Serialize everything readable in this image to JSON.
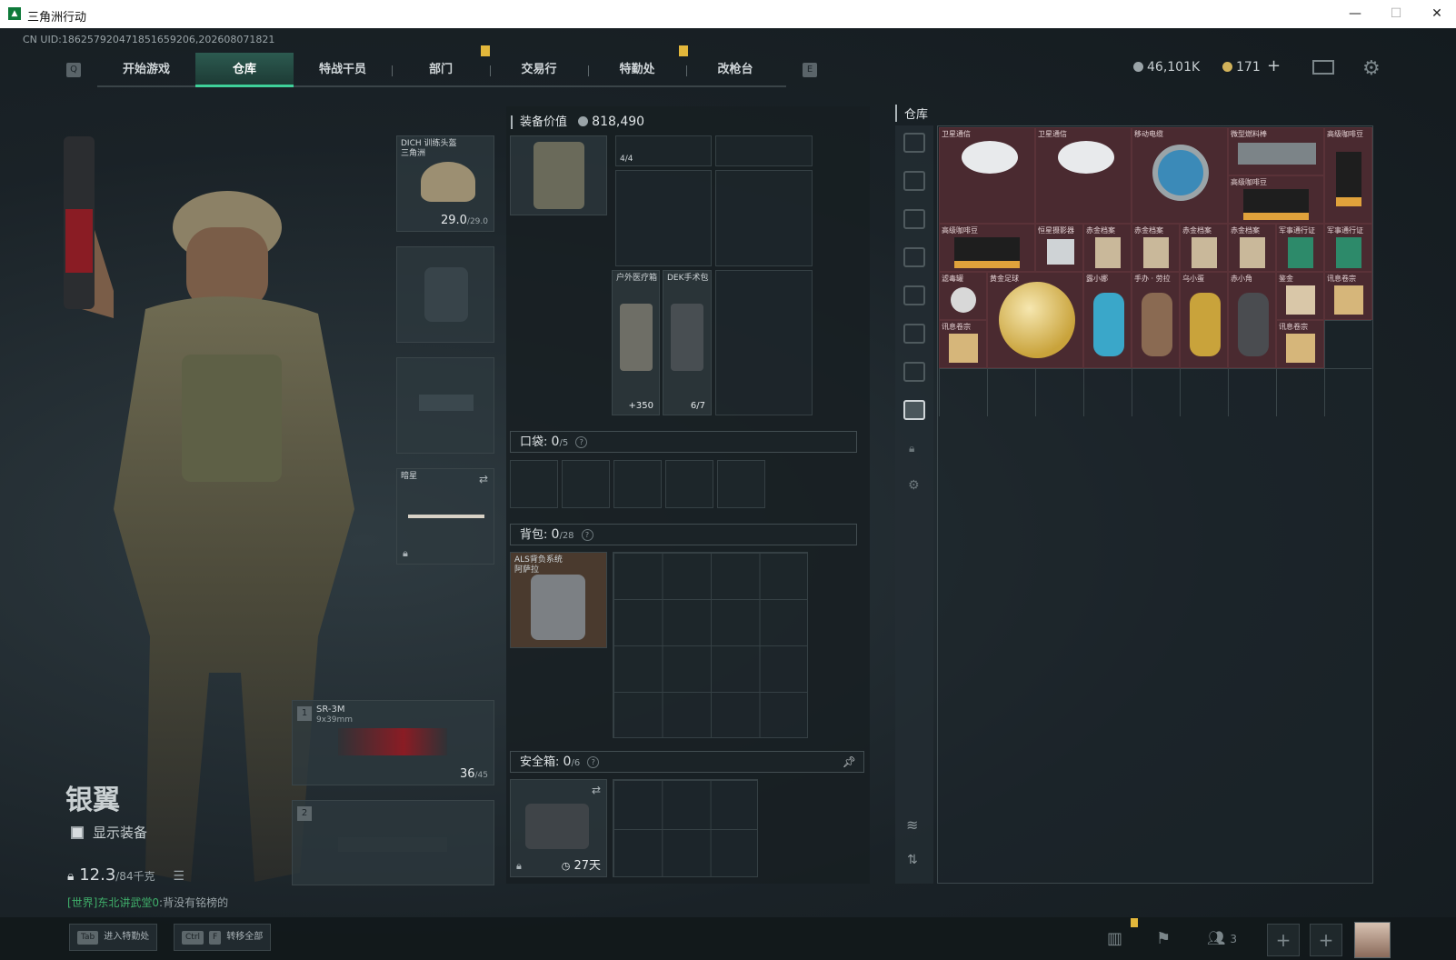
{
  "window": {
    "title": "三角洲行动"
  },
  "header": {
    "uid": "CN UID:18625792047185165920​6,202608071821",
    "key_left": "Q",
    "key_right": "E",
    "tabs": [
      "开始游戏",
      "仓库",
      "特战干员",
      "部门",
      "交易行",
      "特勤处",
      "改枪台"
    ],
    "active_tab": "仓库",
    "currency_a": "46,101K",
    "currency_b": "171",
    "plus": "+",
    "colors": {
      "accent": "#3fd19a",
      "tab_active": "#2c5a50",
      "marker": "#e2b73b"
    }
  },
  "character": {
    "name": "银翼",
    "show_equipment": "显示装备",
    "weight": "12.3",
    "weight_max": "/84千克"
  },
  "chat": {
    "channel": "[世界]",
    "user": "东北讲武堂0",
    "message": "背没有铭榜的"
  },
  "equipment": {
    "helmet": {
      "label": "DICH 训练头盔\n三角洲",
      "value": "29.0",
      "max": "/29.0"
    },
    "melee": {
      "label": "暗星"
    },
    "primary": {
      "index": "1",
      "name": "SR-3M",
      "caliber": "9x39mm",
      "ammo": "36",
      "ammo_max": "/45"
    },
    "secondary": {
      "index": "2"
    }
  },
  "loadout": {
    "value_label": "装备价值",
    "value": "818,490",
    "rig_count": "4/4",
    "medkit": {
      "label": "户外医疗箱",
      "value": "+350"
    },
    "surgery": {
      "label": "DEK手术包",
      "value": "6/7"
    },
    "pocket": {
      "label": "口袋:",
      "value": "0",
      "max": "/5"
    },
    "backpack": {
      "label": "背包:",
      "value": "0",
      "max": "/28",
      "item": "ALS背负系统\n阿萨拉"
    },
    "safebox": {
      "label": "安全箱:",
      "value": "0",
      "max": "/6",
      "days": "27天"
    }
  },
  "warehouse": {
    "title": "仓库",
    "items": [
      {
        "label": "卫星通信"
      },
      {
        "label": "卫星通信"
      },
      {
        "label": "移动电缆"
      },
      {
        "label": "微型燃料棒"
      },
      {
        "label": "高级咖啡豆"
      },
      {
        "label": "高级咖啡豆"
      },
      {
        "label": "高级咖啡豆"
      },
      {
        "label": "恒星摄影器"
      },
      {
        "label": "赤金档案"
      },
      {
        "label": "赤金档案"
      },
      {
        "label": "赤金档案"
      },
      {
        "label": "赤金档案"
      },
      {
        "label": "军事通行证"
      },
      {
        "label": "军事通行证"
      },
      {
        "label": "滤毒罐"
      },
      {
        "label": "黄金足球"
      },
      {
        "label": "露小娜"
      },
      {
        "label": "手办 · 劳拉"
      },
      {
        "label": "乌小蛋"
      },
      {
        "label": "赤小角"
      },
      {
        "label": "鉴金"
      },
      {
        "label": "讯息卷宗"
      },
      {
        "label": "讯息卷宗"
      },
      {
        "label": "讯息卷宗"
      }
    ]
  },
  "footer": {
    "hint1_key": "Tab",
    "hint1": "进入特勤处",
    "hint2_key1": "Ctrl",
    "hint2_key2": "F",
    "hint2": "转移全部",
    "friends": "3"
  }
}
